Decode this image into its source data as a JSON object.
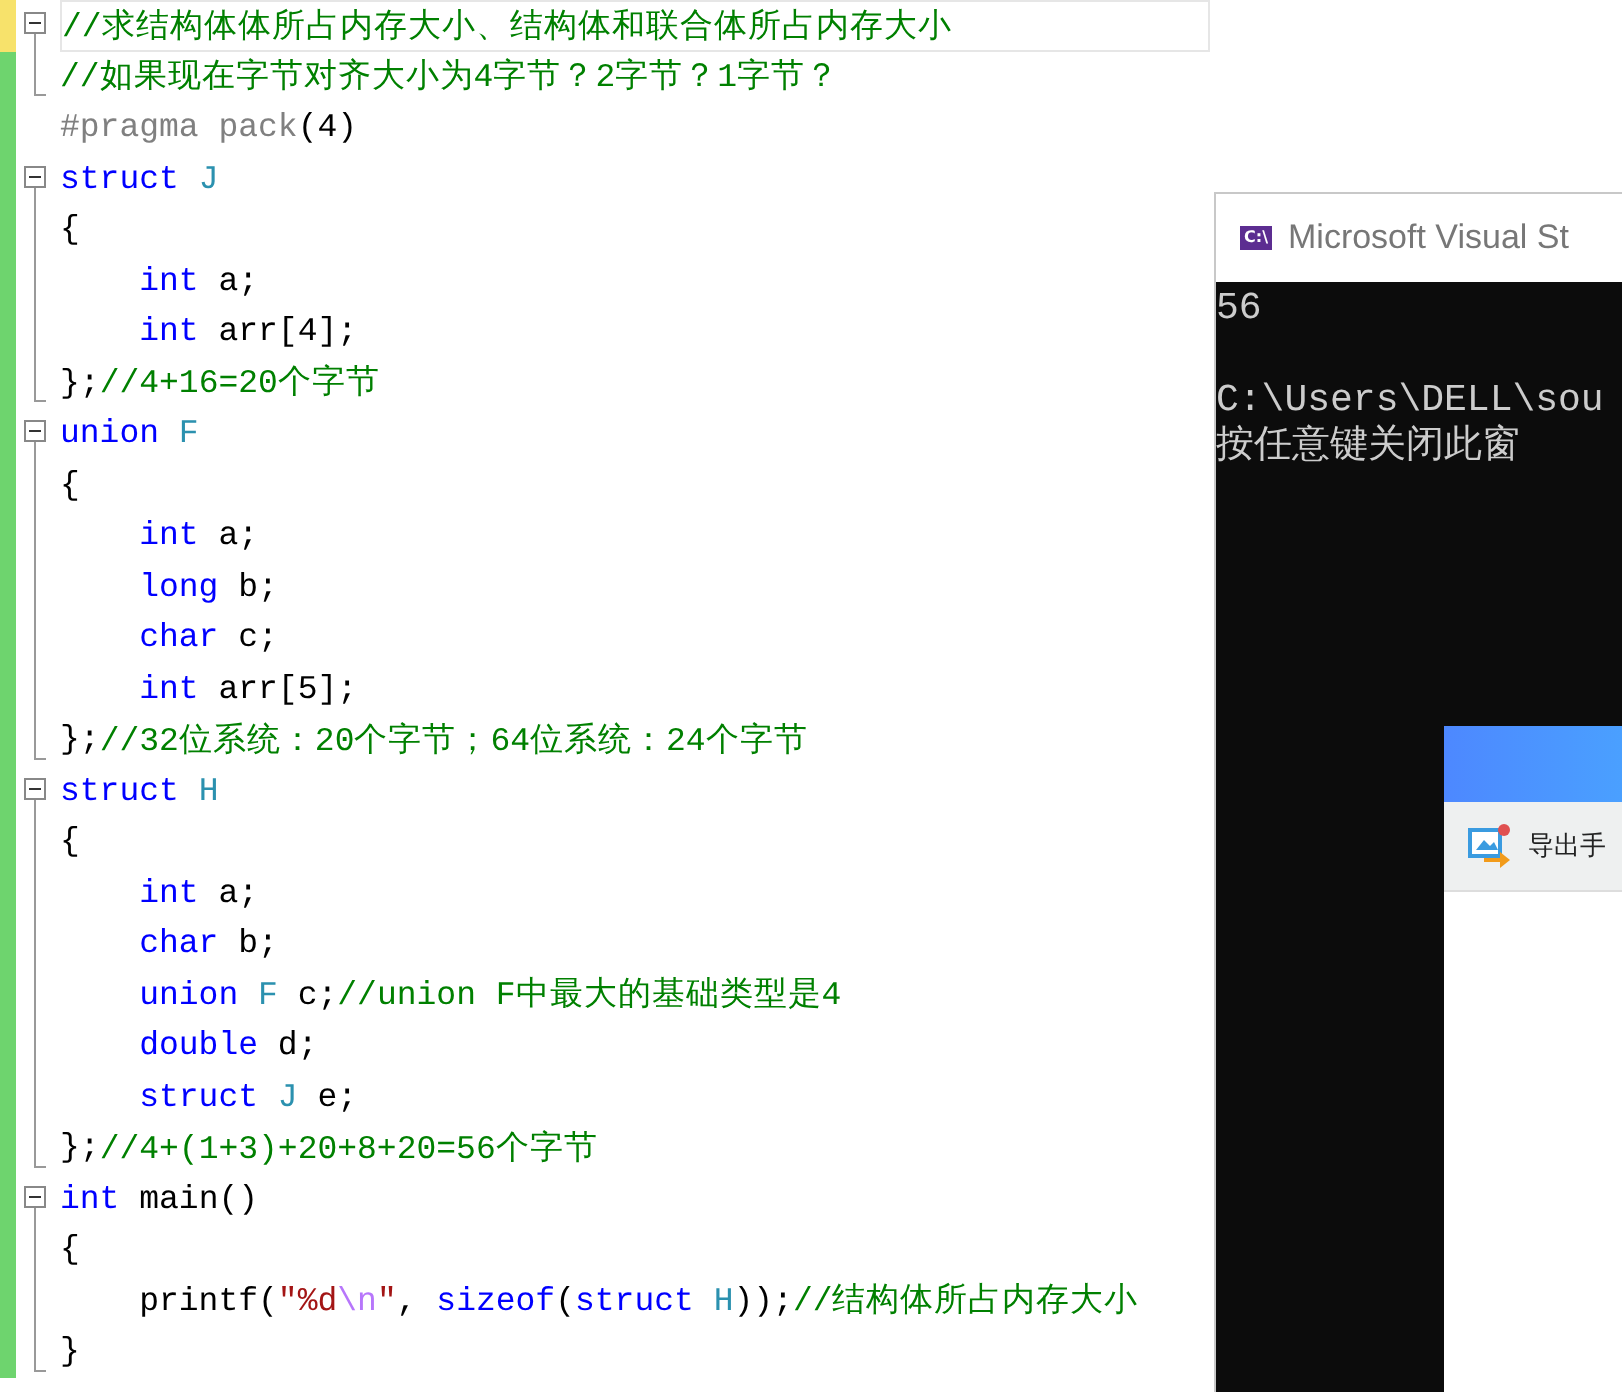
{
  "editor": {
    "blocks": [
      {
        "saved": false,
        "current": true,
        "tokens": [
          {
            "kind": "comment",
            "text": "//求结构体体所占内存大小、结构体和联合体所占内存大小"
          }
        ],
        "children": [
          {
            "saved": true,
            "current": false,
            "tokens": [
              {
                "kind": "comment",
                "text": "//如果现在字节对齐大小为4字节？2字节？1字节？"
              }
            ]
          }
        ]
      },
      {
        "saved": true,
        "current": false,
        "tokens": [
          {
            "kind": "preproc",
            "text": "#pragma pack"
          },
          {
            "kind": "plain",
            "text": "(4)"
          }
        ]
      },
      {
        "saved": true,
        "current": false,
        "tokens": [
          {
            "kind": "keyword",
            "text": "struct "
          },
          {
            "kind": "type",
            "text": "J"
          }
        ],
        "children": [
          {
            "saved": true,
            "current": false,
            "tokens": [
              {
                "kind": "plain",
                "text": "{"
              }
            ]
          },
          {
            "saved": true,
            "current": false,
            "tokens": [
              {
                "kind": "keyword",
                "text": "    int"
              },
              {
                "kind": "plain",
                "text": " a;"
              }
            ]
          },
          {
            "saved": true,
            "current": false,
            "tokens": [
              {
                "kind": "keyword",
                "text": "    int"
              },
              {
                "kind": "plain",
                "text": " arr[4];"
              }
            ]
          },
          {
            "saved": true,
            "current": false,
            "tokens": [
              {
                "kind": "plain",
                "text": "};"
              },
              {
                "kind": "comment",
                "text": "//4+16=20个字节"
              }
            ]
          }
        ]
      },
      {
        "saved": true,
        "current": false,
        "tokens": [
          {
            "kind": "keyword",
            "text": "union "
          },
          {
            "kind": "type",
            "text": "F"
          }
        ],
        "children": [
          {
            "saved": true,
            "current": false,
            "tokens": [
              {
                "kind": "plain",
                "text": "{"
              }
            ]
          },
          {
            "saved": true,
            "current": false,
            "tokens": [
              {
                "kind": "keyword",
                "text": "    int"
              },
              {
                "kind": "plain",
                "text": " a;"
              }
            ]
          },
          {
            "saved": true,
            "current": false,
            "tokens": [
              {
                "kind": "keyword",
                "text": "    long"
              },
              {
                "kind": "plain",
                "text": " b;"
              }
            ]
          },
          {
            "saved": true,
            "current": false,
            "tokens": [
              {
                "kind": "keyword",
                "text": "    char"
              },
              {
                "kind": "plain",
                "text": " c;"
              }
            ]
          },
          {
            "saved": true,
            "current": false,
            "tokens": [
              {
                "kind": "keyword",
                "text": "    int"
              },
              {
                "kind": "plain",
                "text": " arr[5];"
              }
            ]
          },
          {
            "saved": true,
            "current": false,
            "tokens": [
              {
                "kind": "plain",
                "text": "};"
              },
              {
                "kind": "comment",
                "text": "//32位系统：20个字节；64位系统：24个字节"
              }
            ]
          }
        ]
      },
      {
        "saved": true,
        "current": false,
        "tokens": [
          {
            "kind": "keyword",
            "text": "struct "
          },
          {
            "kind": "type",
            "text": "H"
          }
        ],
        "children": [
          {
            "saved": true,
            "current": false,
            "tokens": [
              {
                "kind": "plain",
                "text": "{"
              }
            ]
          },
          {
            "saved": true,
            "current": false,
            "tokens": [
              {
                "kind": "keyword",
                "text": "    int"
              },
              {
                "kind": "plain",
                "text": " a;"
              }
            ]
          },
          {
            "saved": true,
            "current": false,
            "tokens": [
              {
                "kind": "keyword",
                "text": "    char"
              },
              {
                "kind": "plain",
                "text": " b;"
              }
            ]
          },
          {
            "saved": true,
            "current": false,
            "tokens": [
              {
                "kind": "keyword",
                "text": "    union "
              },
              {
                "kind": "type",
                "text": "F"
              },
              {
                "kind": "plain",
                "text": " c;"
              },
              {
                "kind": "comment",
                "text": "//union F中最大的基础类型是4"
              }
            ]
          },
          {
            "saved": true,
            "current": false,
            "tokens": [
              {
                "kind": "keyword",
                "text": "    double"
              },
              {
                "kind": "plain",
                "text": " d;"
              }
            ]
          },
          {
            "saved": true,
            "current": false,
            "tokens": [
              {
                "kind": "keyword",
                "text": "    struct "
              },
              {
                "kind": "type",
                "text": "J"
              },
              {
                "kind": "plain",
                "text": " e;"
              }
            ]
          },
          {
            "saved": true,
            "current": false,
            "tokens": [
              {
                "kind": "plain",
                "text": "};"
              },
              {
                "kind": "comment",
                "text": "//4+(1+3)+20+8+20=56个字节"
              }
            ]
          }
        ]
      },
      {
        "saved": true,
        "current": false,
        "tokens": [
          {
            "kind": "keyword",
            "text": "int"
          },
          {
            "kind": "plain",
            "text": " main()"
          }
        ],
        "children": [
          {
            "saved": true,
            "current": false,
            "tokens": [
              {
                "kind": "plain",
                "text": "{"
              }
            ]
          },
          {
            "saved": true,
            "current": false,
            "tokens": [
              {
                "kind": "plain",
                "text": "    printf("
              },
              {
                "kind": "string",
                "text": "\"%d"
              },
              {
                "kind": "escape",
                "text": "\\n"
              },
              {
                "kind": "string",
                "text": "\""
              },
              {
                "kind": "plain",
                "text": ", "
              },
              {
                "kind": "keyword",
                "text": "sizeof"
              },
              {
                "kind": "plain",
                "text": "("
              },
              {
                "kind": "keyword",
                "text": "struct "
              },
              {
                "kind": "type",
                "text": "H"
              },
              {
                "kind": "plain",
                "text": "));"
              },
              {
                "kind": "comment",
                "text": "//结构体所占内存大小"
              }
            ]
          },
          {
            "saved": true,
            "current": false,
            "tokens": [
              {
                "kind": "plain",
                "text": "}"
              }
            ]
          }
        ]
      }
    ]
  },
  "console": {
    "title": "Microsoft Visual St",
    "icon_text": "C:\\",
    "output_blocks": [
      [
        "56"
      ],
      [
        "C:\\Users\\DELL\\sou",
        "按任意键关闭此窗"
      ]
    ],
    "popup": {
      "item": "导出手"
    }
  }
}
